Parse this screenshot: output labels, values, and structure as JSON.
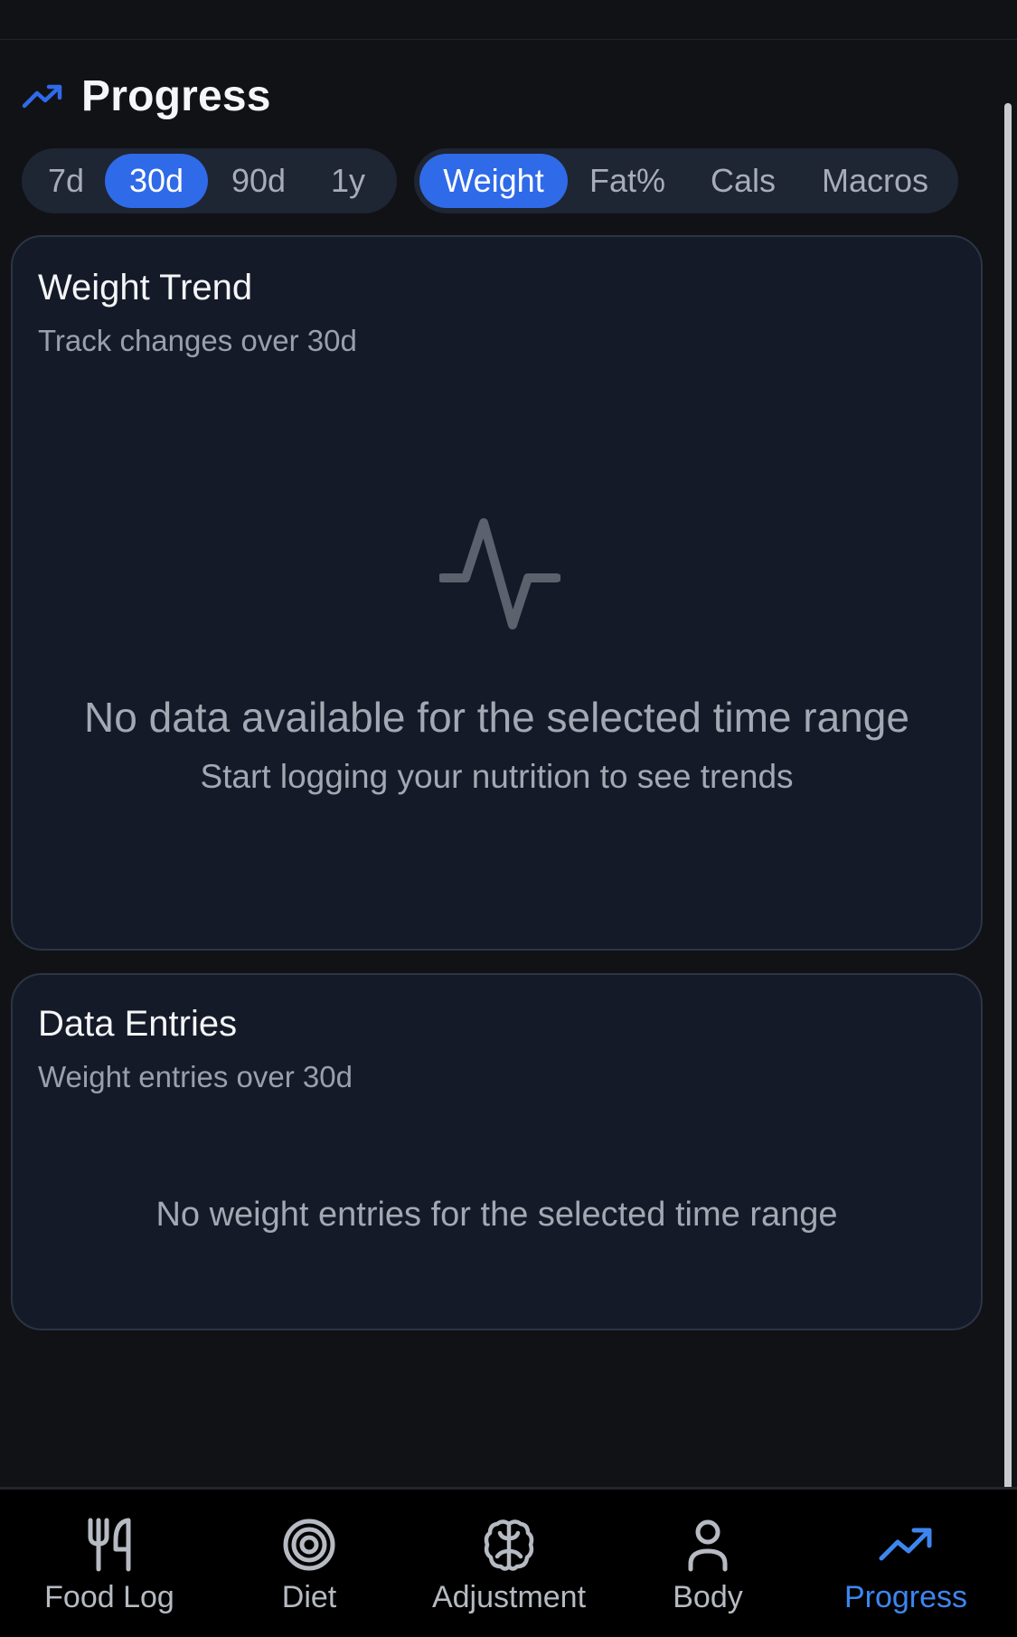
{
  "header": {
    "title": "Progress",
    "icon": "trending-up-icon"
  },
  "range_selector": {
    "options": [
      "7d",
      "30d",
      "90d",
      "1y"
    ],
    "selected": "30d"
  },
  "metric_selector": {
    "options": [
      "Weight",
      "Fat%",
      "Cals",
      "Macros"
    ],
    "selected": "Weight"
  },
  "trend_card": {
    "title": "Weight Trend",
    "subtitle": "Track changes over 30d",
    "empty_icon": "activity-pulse-icon",
    "empty_title": "No data available for the selected time range",
    "empty_subtitle": "Start logging your nutrition to see trends"
  },
  "entries_card": {
    "title": "Data Entries",
    "subtitle": "Weight entries over 30d",
    "empty_text": "No weight entries for the selected time range"
  },
  "tabbar": {
    "items": [
      {
        "label": "Food Log",
        "icon": "fork-knife-icon"
      },
      {
        "label": "Diet",
        "icon": "target-icon"
      },
      {
        "label": "Adjustment",
        "icon": "brain-icon"
      },
      {
        "label": "Body",
        "icon": "person-icon"
      },
      {
        "label": "Progress",
        "icon": "trending-up-icon"
      }
    ],
    "active": "Progress"
  },
  "colors": {
    "background": "#111216",
    "card": "#141a28",
    "accent": "#2f6ae8",
    "active_tab": "#3d86ef",
    "muted_text": "#a3a8b2"
  }
}
